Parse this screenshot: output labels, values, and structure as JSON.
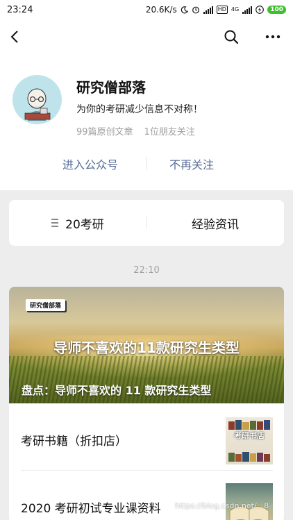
{
  "status_bar": {
    "time": "23:24",
    "network_speed": "20.6K/s",
    "network_type": "4G",
    "hd_label": "HD",
    "battery": "100"
  },
  "nav": {
    "back_icon": "chevron-left-icon",
    "search_icon": "search-icon",
    "more_icon": "more-icon"
  },
  "account": {
    "name": "研究僧部落",
    "description": "为你的考研减少信息不对称！",
    "articles_count": "99篇原创文章",
    "friends_following": "1位朋友关注",
    "enter_label": "进入公众号",
    "unfollow_label": "不再关注",
    "avatar_book_text": "研究僧部落"
  },
  "menu": {
    "items": [
      {
        "label": "20考研",
        "has_submenu": true
      },
      {
        "label": "经验资讯",
        "has_submenu": false
      }
    ]
  },
  "feed": {
    "timestamp": "22:10",
    "cover": {
      "badge": "研究僧部落",
      "headline": "导师不喜欢的11款研究生类型",
      "caption": "盘点：导师不喜欢的 11 款研究生类型"
    },
    "articles": [
      {
        "title": "考研书籍（折扣店）",
        "thumb_text": "考研书店"
      },
      {
        "title": "2020 考研初试专业课资料",
        "thumb_text": ""
      }
    ]
  },
  "watermark": "https://blog.csdn.net/...8"
}
